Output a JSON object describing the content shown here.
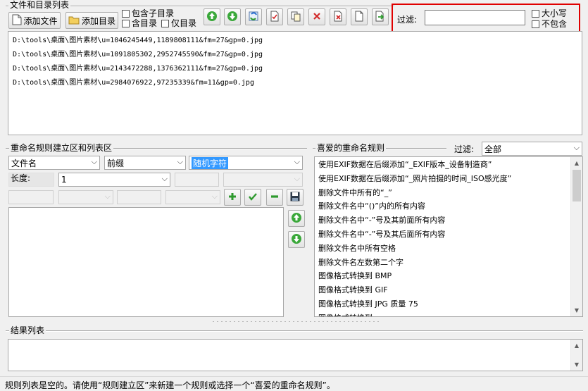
{
  "files_section": {
    "title": "文件和目录列表",
    "add_file_label": "添加文件",
    "add_dir_label": "添加目录",
    "include_subdirs_label": "包含子目录",
    "include_dirs_label": "含目录",
    "dirs_only_label": "仅目录",
    "filter_label": "过滤:",
    "filter_value": "",
    "case_label": "大小写",
    "exclude_label": "不包含",
    "files": [
      "D:\\tools\\桌面\\图片素材\\u=1046245449,1189808111&fm=27&gp=0.jpg",
      "D:\\tools\\桌面\\图片素材\\u=1091805302,2952745590&fm=27&gp=0.jpg",
      "D:\\tools\\桌面\\图片素材\\u=2143472288,1376362111&fm=27&gp=0.jpg",
      "D:\\tools\\桌面\\图片素材\\u=2984076922,97235339&fm=11&gp=0.jpg"
    ]
  },
  "rules_section": {
    "title": "重命名规则建立区和列表区",
    "type_select": "文件名",
    "position_select": "前缀",
    "value_select": "随机字符",
    "length_label": "长度:",
    "length_value": "1"
  },
  "favorites_section": {
    "title": "喜爱的重命名规则",
    "filter_label": "过滤:",
    "filter_value": "全部",
    "items": [
      "使用EXIF数据在后缀添加“_EXIF版本_设备制造商”",
      "使用EXIF数据在后缀添加“_照片拍摄的时间_ISO感光度”",
      "删除文件中所有的“_”",
      "删除文件名中“()”内的所有内容",
      "删除文件名中“-”号及其前面所有内容",
      "删除文件名中“-”号及其后面所有内容",
      "删除文件名中所有空格",
      "删除文件名左数第二个字",
      "图像格式转换到 BMP",
      "图像格式转换到 GIF",
      "图像格式转换到 JPG 质量 75",
      "图像格式转换到"
    ]
  },
  "results_section": {
    "title": "结果列表"
  },
  "status_text": "规则列表是空的。请使用“规则建立区”来新建一个规则或选择一个“喜爱的重命名规则”。",
  "colors": {
    "highlight_border": "#e00000",
    "selection": "#3399ff",
    "green_icon": "#2e9a2e",
    "red_icon": "#d22a2a"
  }
}
